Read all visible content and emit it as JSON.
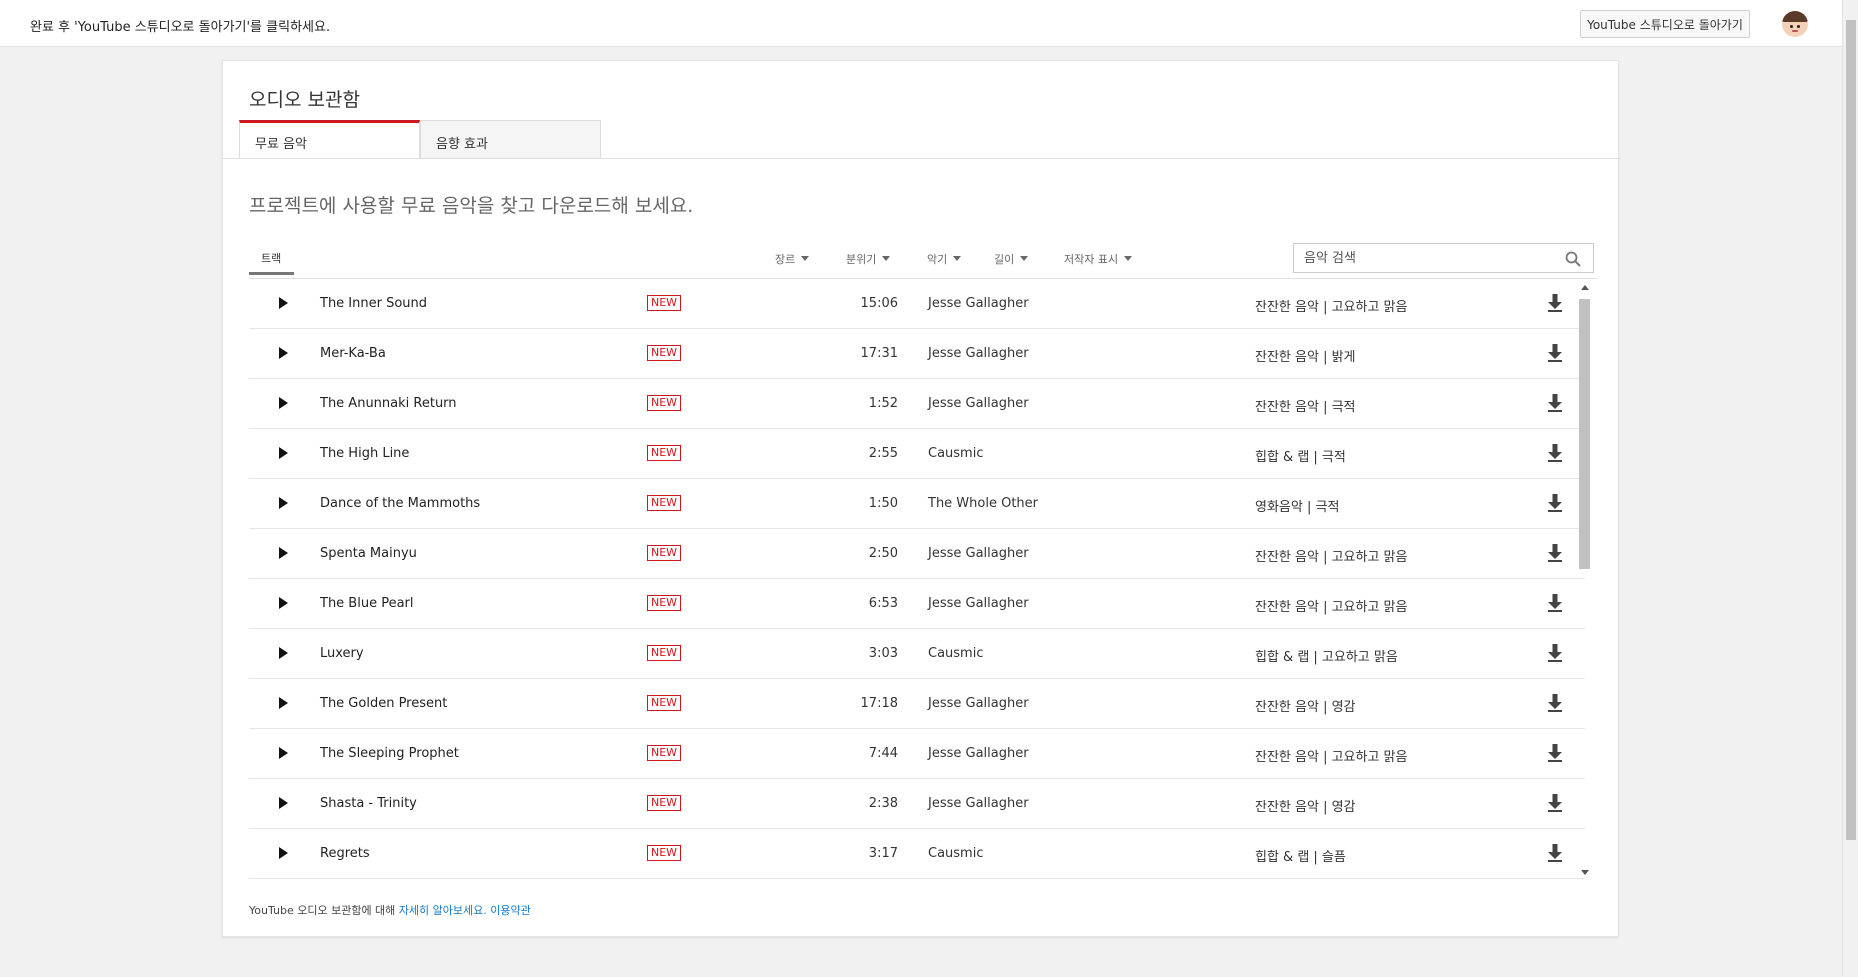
{
  "topbar": {
    "message": "완료 후 'YouTube 스튜디오로 돌아가기'를 클릭하세요.",
    "return_button": "YouTube 스튜디오로 돌아가기"
  },
  "card": {
    "title": "오디오 보관함",
    "tabs": [
      {
        "label": "무료 음악",
        "active": true
      },
      {
        "label": "음향 효과",
        "active": false
      }
    ],
    "subtitle": "프로젝트에 사용할 무료 음악을 찾고 다운로드해 보세요."
  },
  "filters": {
    "track_header": "트랙",
    "items": [
      "장르",
      "분위기",
      "악기",
      "길이",
      "저작자 표시"
    ],
    "search_placeholder": "음악 검색"
  },
  "tracks": [
    {
      "title": "The Inner Sound",
      "badge": "NEW",
      "duration": "15:06",
      "artist": "Jesse Gallagher",
      "genre": "잔잔한 음악 | 고요하고 맑음"
    },
    {
      "title": "Mer-Ka-Ba",
      "badge": "NEW",
      "duration": "17:31",
      "artist": "Jesse Gallagher",
      "genre": "잔잔한 음악 | 밝게"
    },
    {
      "title": "The Anunnaki Return",
      "badge": "NEW",
      "duration": "1:52",
      "artist": "Jesse Gallagher",
      "genre": "잔잔한 음악 | 극적"
    },
    {
      "title": "The High Line",
      "badge": "NEW",
      "duration": "2:55",
      "artist": "Causmic",
      "genre": "힙합 & 랩 | 극적"
    },
    {
      "title": "Dance of the Mammoths",
      "badge": "NEW",
      "duration": "1:50",
      "artist": "The Whole Other",
      "genre": "영화음악 | 극적"
    },
    {
      "title": "Spenta Mainyu",
      "badge": "NEW",
      "duration": "2:50",
      "artist": "Jesse Gallagher",
      "genre": "잔잔한 음악 | 고요하고 맑음"
    },
    {
      "title": "The Blue Pearl",
      "badge": "NEW",
      "duration": "6:53",
      "artist": "Jesse Gallagher",
      "genre": "잔잔한 음악 | 고요하고 맑음"
    },
    {
      "title": "Luxery",
      "badge": "NEW",
      "duration": "3:03",
      "artist": "Causmic",
      "genre": "힙합 & 랩 | 고요하고 맑음"
    },
    {
      "title": "The Golden Present",
      "badge": "NEW",
      "duration": "17:18",
      "artist": "Jesse Gallagher",
      "genre": "잔잔한 음악 | 영감"
    },
    {
      "title": "The Sleeping Prophet",
      "badge": "NEW",
      "duration": "7:44",
      "artist": "Jesse Gallagher",
      "genre": "잔잔한 음악 | 고요하고 맑음"
    },
    {
      "title": "Shasta - Trinity",
      "badge": "NEW",
      "duration": "2:38",
      "artist": "Jesse Gallagher",
      "genre": "잔잔한 음악 | 영감"
    },
    {
      "title": "Regrets",
      "badge": "NEW",
      "duration": "3:17",
      "artist": "Causmic",
      "genre": "힙합 & 랩 | 슬픔"
    }
  ],
  "footer": {
    "text": "YouTube 오디오 보관함에 대해",
    "learn_more": "자세히 알아보세요.",
    "terms": "이용약관"
  },
  "colors": {
    "accent_red": "#cc181e",
    "link_blue": "#167ac6"
  }
}
